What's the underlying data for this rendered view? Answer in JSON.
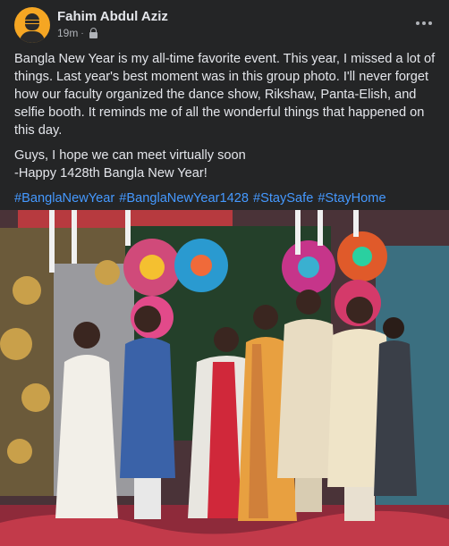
{
  "post": {
    "author": "Fahim Abdul Aziz",
    "time": "19m",
    "separator": "·",
    "privacy_icon": "lock-icon",
    "more_icon": "more-horizontal-icon",
    "paragraphs": [
      "Bangla New Year is my all-time favorite event. This year, I missed a lot of things. Last year's best moment was in this group photo. I'll never forget how our faculty organized the dance show, Rikshaw, Panta-Elish, and selfie booth. It reminds me of all the wonderful things that happened on this day.",
      "Guys, I hope we can meet virtually soon\n-Happy 1428th Bangla New Year!"
    ],
    "hashtags": [
      "#BanglaNewYear",
      "#BanglaNewYear1428",
      "#StaySafe",
      "#StayHome"
    ],
    "link_color": "#4599ff"
  }
}
